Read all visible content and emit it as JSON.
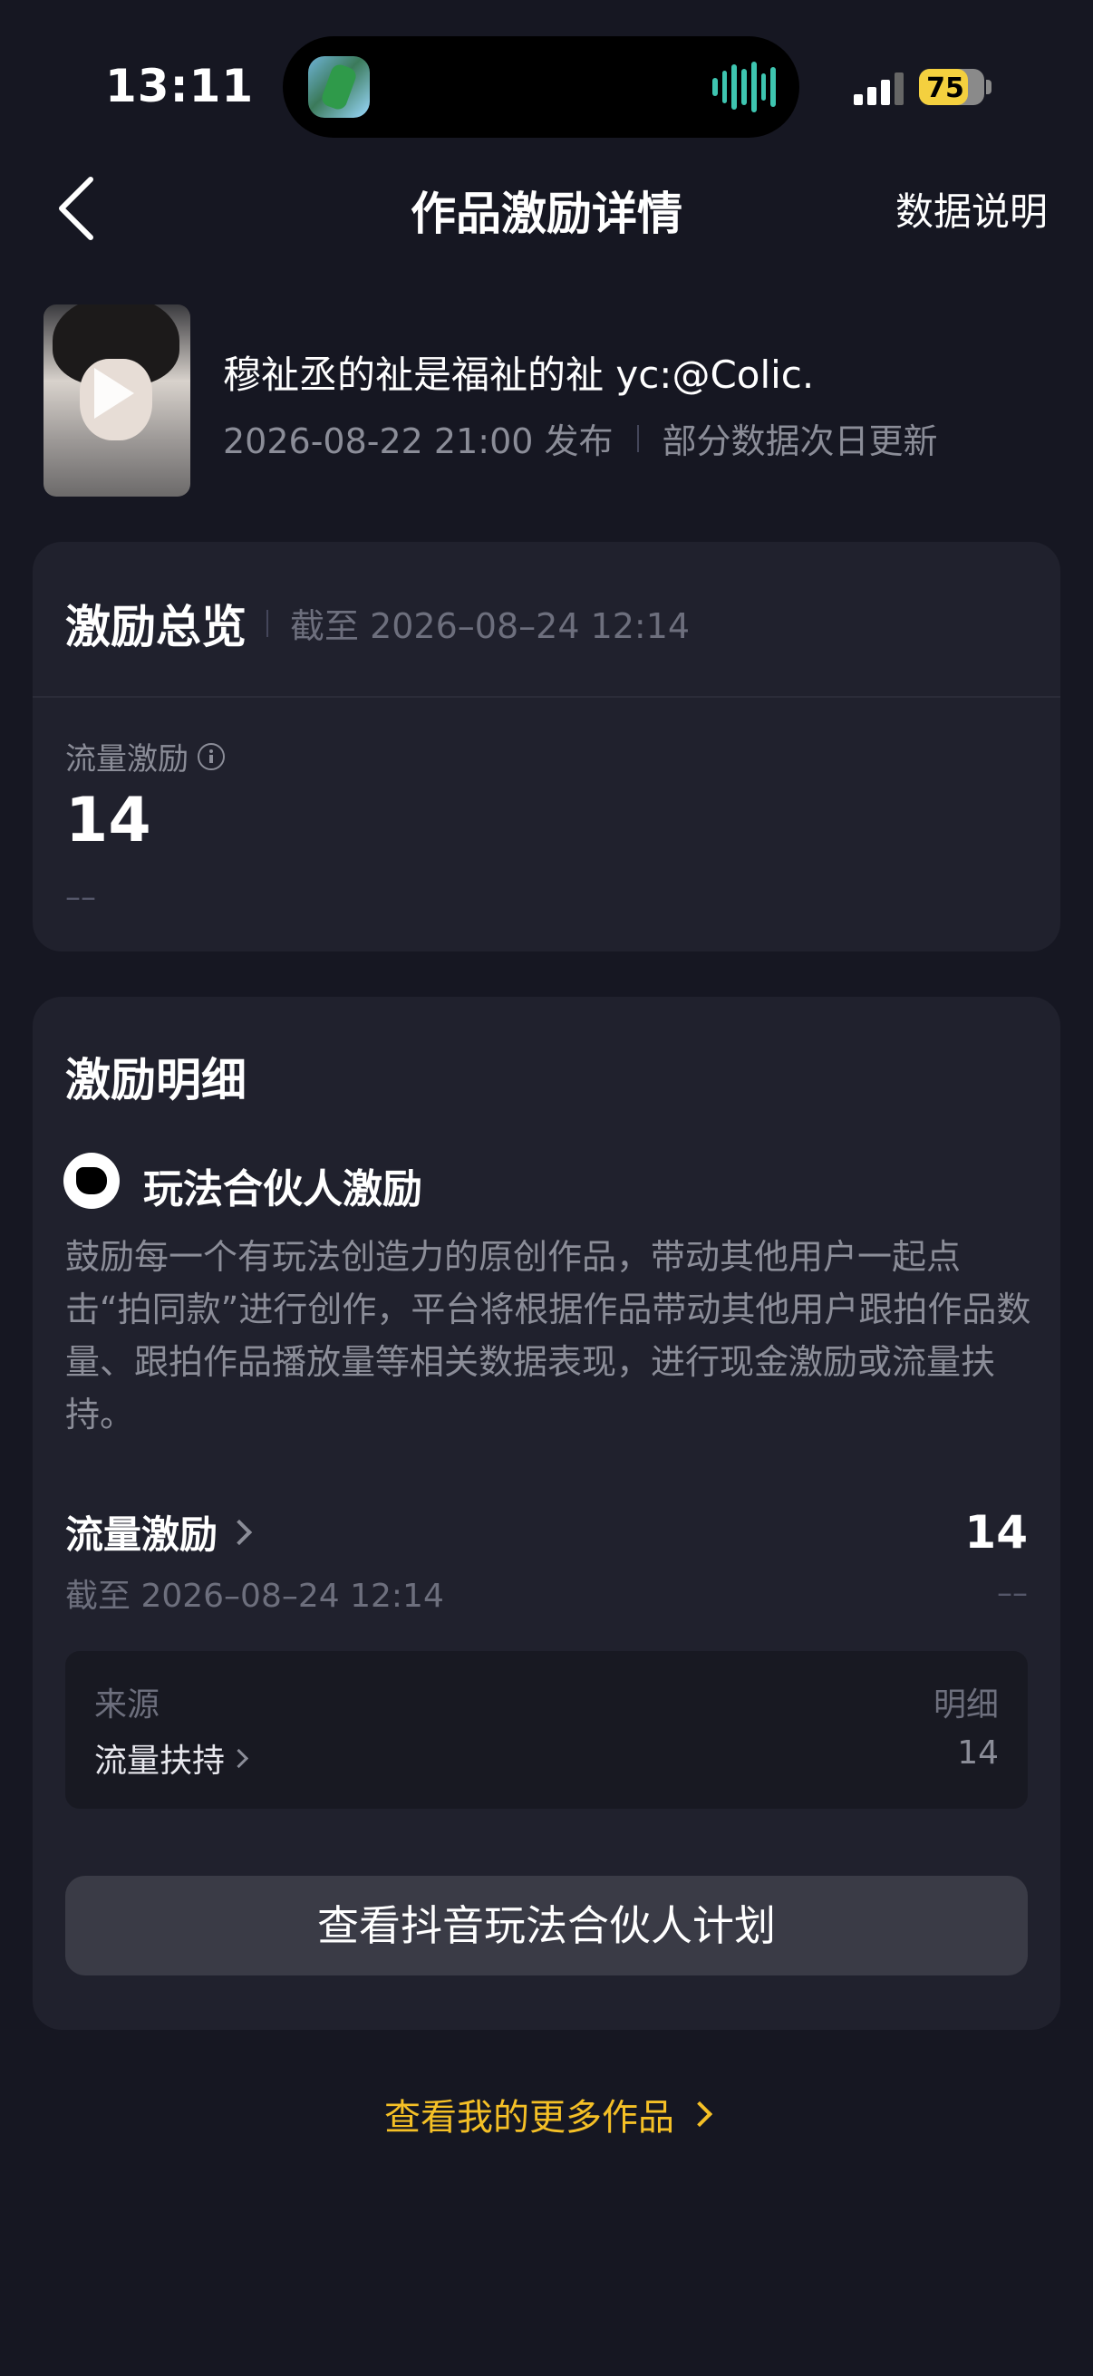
{
  "status_bar": {
    "time": "13:11",
    "battery": "75",
    "battery_level": 0.75
  },
  "nav": {
    "title": "作品激励详情",
    "right_action": "数据说明",
    "back_icon": "chevron-left-icon"
  },
  "video": {
    "title": "穆祉丞的祉是福祉的祉 yc:@Colic.",
    "publish_time": "2026-08-22 21:00 发布",
    "update_note": "部分数据次日更新"
  },
  "overview": {
    "title": "激励总览",
    "as_of": "截至 2026–08–24 12:14",
    "flow_label": "流量激励",
    "flow_value": "14",
    "flow_dash": "––"
  },
  "detail": {
    "title": "激励明细",
    "program_name": "玩法合伙人激励",
    "program_desc": "鼓励每一个有玩法创造力的原创作品，带动其他用户一起点击“拍同款”进行创作，平台将根据作品带动其他用户跟拍作品数量、跟拍作品播放量等相关数据表现，进行现金激励或流量扶持。",
    "row_label": "流量激励",
    "row_date": "截至 2026–08–24 12:14",
    "row_value": "14",
    "row_dash": "––",
    "source_header": "来源",
    "detail_header": "明细",
    "source_item": "流量扶持",
    "source_value": "14",
    "plan_button": "查看抖音玩法合伙人计划"
  },
  "more_works_link": "查看我的更多作品",
  "colors": {
    "background": "#161722",
    "card": "#20212d",
    "accent": "#f5c026"
  }
}
